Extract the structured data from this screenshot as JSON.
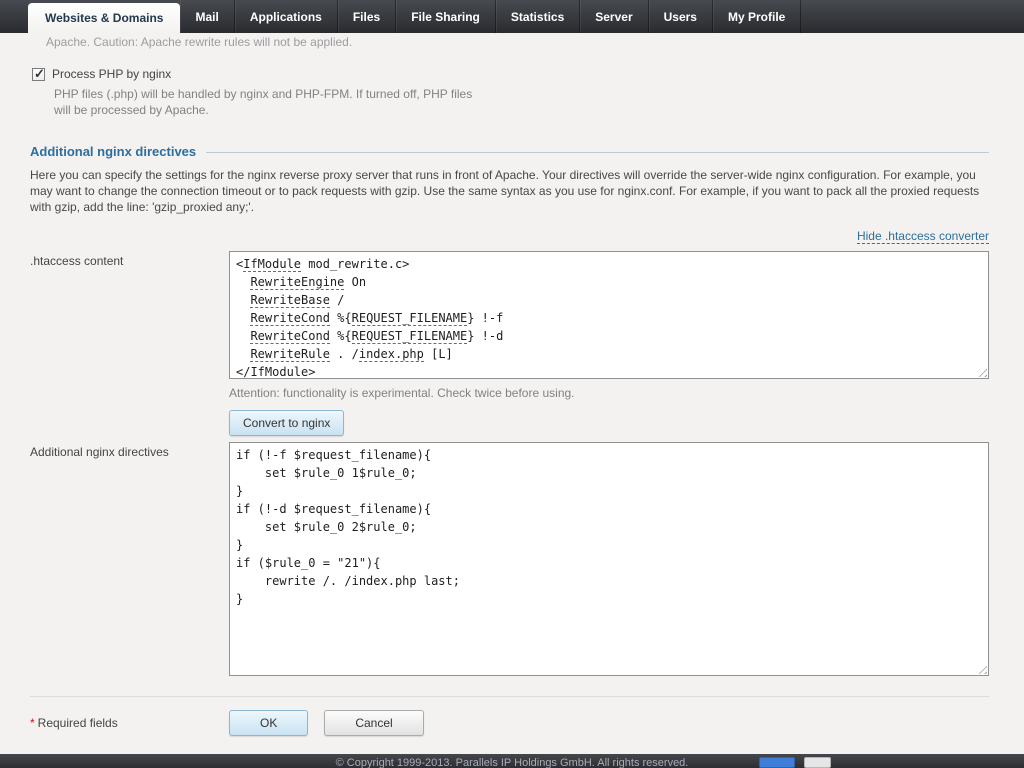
{
  "tabs": [
    {
      "label": "Websites & Domains"
    },
    {
      "label": "Mail"
    },
    {
      "label": "Applications"
    },
    {
      "label": "Files"
    },
    {
      "label": "File Sharing"
    },
    {
      "label": "Statistics"
    },
    {
      "label": "Server"
    },
    {
      "label": "Users"
    },
    {
      "label": "My Profile"
    }
  ],
  "content": {
    "clipped_description": "Apache. Caution: Apache rewrite rules will not be applied.",
    "php_option": {
      "label": "Process PHP by nginx",
      "checked": true,
      "description": "PHP files (.php) will be handled by nginx and PHP-FPM. If turned off, PHP files will be processed by Apache."
    },
    "section_title": "Additional nginx directives",
    "section_description": "Here you can specify the settings for the nginx reverse proxy server that runs in front of Apache. Your directives will override the server-wide nginx configuration. For example, you may want to change the connection timeout or to pack requests with gzip. Use the same syntax as you use for nginx.conf. For example, if you want to pack all the proxied requests with gzip, add the line: 'gzip_proxied any;'.",
    "toggle_converter_link": "Hide .htaccess converter",
    "htaccess": {
      "label": ".htaccess content",
      "value": "<IfModule mod_rewrite.c>\n  RewriteEngine On\n  RewriteBase /\n  RewriteCond %{REQUEST_FILENAME} !-f\n  RewriteCond %{REQUEST_FILENAME} !-d\n  RewriteRule . /index.php [L]\n</IfModule>",
      "misspelled": [
        "RewriteEngine",
        "RewriteBase",
        "RewriteCond",
        "REQUEST_FILENAME",
        "RewriteRule",
        "index.php",
        "IfModule"
      ],
      "attention": "Attention: functionality is experimental. Check twice before using.",
      "convert_button": "Convert to nginx"
    },
    "directives": {
      "label": "Additional nginx directives",
      "value": "if (!-f $request_filename){\n    set $rule_0 1$rule_0;\n}\nif (!-d $request_filename){\n    set $rule_0 2$rule_0;\n}\nif ($rule_0 = \"21\"){\n    rewrite /. /index.php last;\n}"
    },
    "required_asterisk": "*",
    "required_note": "Required fields",
    "ok_button": "OK",
    "cancel_button": "Cancel"
  },
  "footer": {
    "copyright": "© Copyright 1999-2013. Parallels IP Holdings GmbH. All rights reserved."
  },
  "colors": {
    "accent_blue": "#2e6e9e",
    "tab_bar_dark": "#2c2e32",
    "required_red": "#cc1111"
  }
}
